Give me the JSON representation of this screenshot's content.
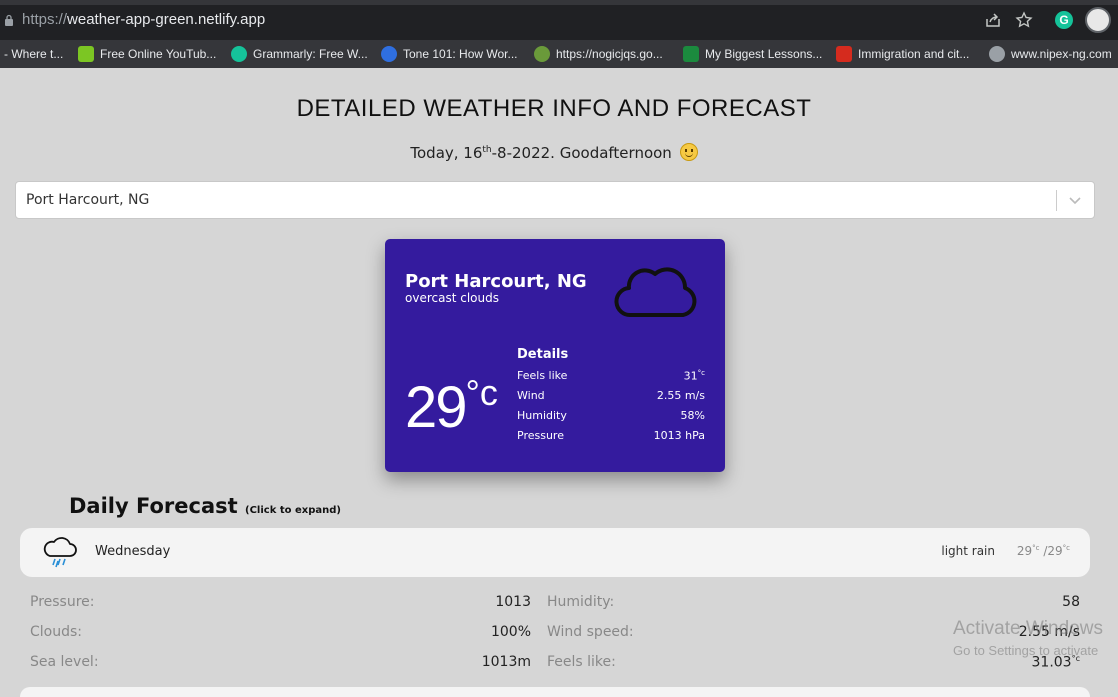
{
  "browser": {
    "url_host": "weather-app-green.netlify.app",
    "url_scheme": "https://",
    "bookmarks": [
      {
        "label": "- Where t...",
        "icon": "page-icon",
        "color": "#5f6368"
      },
      {
        "label": "Free Online YouTub...",
        "icon": "download-arrow-icon",
        "color": "#7cc623"
      },
      {
        "label": "Grammarly: Free W...",
        "icon": "grammarly-icon",
        "color": "#15c39a"
      },
      {
        "label": "Tone 101: How Wor...",
        "icon": "tone-icon",
        "color": "#2f6fe0"
      },
      {
        "label": "https://nogicjqs.go...",
        "icon": "gear-favicon",
        "color": "#6a9a3a"
      },
      {
        "label": "My Biggest Lessons...",
        "icon": "naira-icon",
        "color": "#1b8a3e"
      },
      {
        "label": "Immigration and cit...",
        "icon": "maple-leaf-icon",
        "color": "#d52b1e"
      },
      {
        "label": "www.nipex-ng.com",
        "icon": "globe-icon",
        "color": "#9aa0a6"
      }
    ]
  },
  "header": {
    "title": "DETAILED WEATHER INFO AND FORECAST",
    "date_prefix": "Today, 16",
    "date_suffix": "th",
    "date_rest": "-8-2022. Goodafternoon"
  },
  "search": {
    "selected": "Port Harcourt, NG"
  },
  "current": {
    "city": "Port Harcourt, NG",
    "description": "overcast clouds",
    "temp": "29",
    "temp_unit": "°c",
    "details_heading": "Details",
    "details": [
      {
        "label": "Feels like",
        "value": "31",
        "unit": "°c"
      },
      {
        "label": "Wind",
        "value": "2.55 m/s",
        "unit": ""
      },
      {
        "label": "Humidity",
        "value": "58%",
        "unit": ""
      },
      {
        "label": "Pressure",
        "value": "1013 hPa",
        "unit": ""
      }
    ],
    "card_color": "#341b9e"
  },
  "forecast": {
    "heading": "Daily Forecast",
    "hint": "(Click to expand)",
    "day": "Wednesday",
    "condition": "light rain",
    "min": "29",
    "max": "29",
    "deg": "°c",
    "stats_left": [
      {
        "label": "Pressure:",
        "value": "1013"
      },
      {
        "label": "Clouds:",
        "value": "100%"
      },
      {
        "label": "Sea level:",
        "value": "1013m"
      }
    ],
    "stats_right": [
      {
        "label": "Humidity:",
        "value": "58"
      },
      {
        "label": "Wind speed:",
        "value": "2.55 m/s"
      },
      {
        "label": "Feels like:",
        "value": "31.03",
        "unit": "°c"
      }
    ]
  },
  "overlay": {
    "line1": "Activate Windows",
    "line2": "Go to Settings to activate"
  }
}
